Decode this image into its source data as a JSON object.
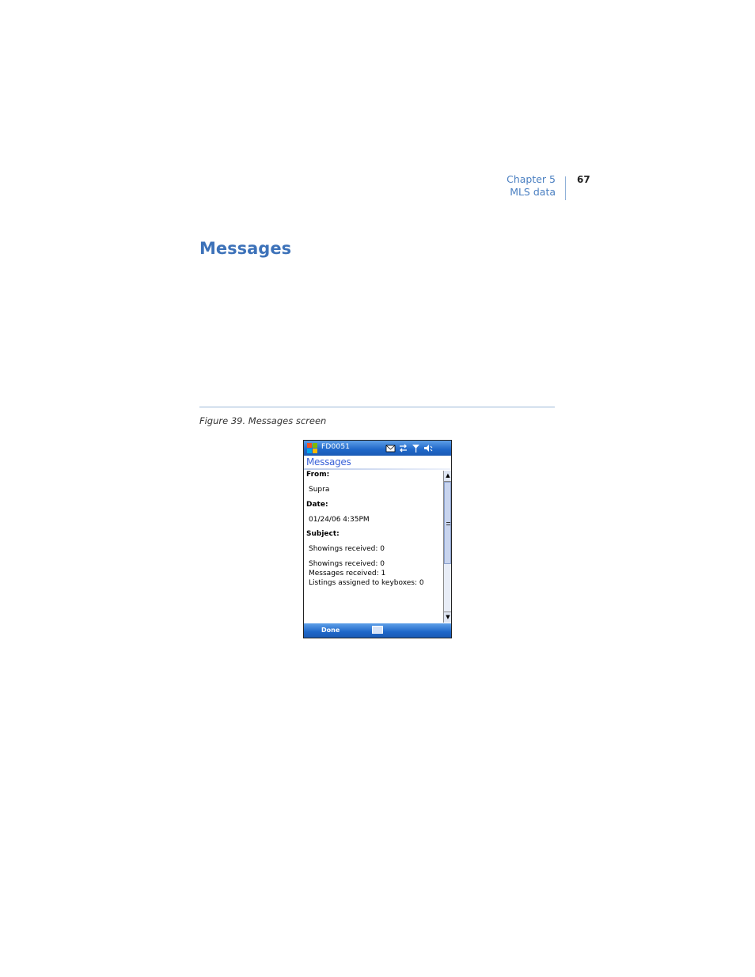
{
  "header": {
    "chapter": "Chapter 5",
    "section": "MLS data",
    "page_number": "67"
  },
  "section_title": "Messages",
  "figure_caption": "Figure 39.  Messages screen",
  "device": {
    "device_name": "FD0051",
    "app_title": "Messages",
    "fields": {
      "from_label": "From:",
      "from_value": "Supra",
      "date_label": "Date:",
      "date_value": "01/24/06 4:35PM",
      "subject_label": "Subject:",
      "subject_value": "Showings received: 0"
    },
    "body_lines": [
      "Showings received: 0",
      "Messages received: 1",
      "Listings assigned to keyboxes: 0"
    ],
    "menu": {
      "done_label": "Done"
    },
    "icons": {
      "start": "windows-flag-icon",
      "status": [
        "envelope-icon",
        "sync-arrows-icon",
        "signal-antenna-icon",
        "speaker-muted-icon"
      ],
      "input": "keyboard-icon"
    },
    "colors": {
      "bar": "#1f67c8",
      "title": "#3a62d8"
    }
  },
  "colors": {
    "heading": "#3d72b9",
    "header_text": "#4a7fc1"
  }
}
